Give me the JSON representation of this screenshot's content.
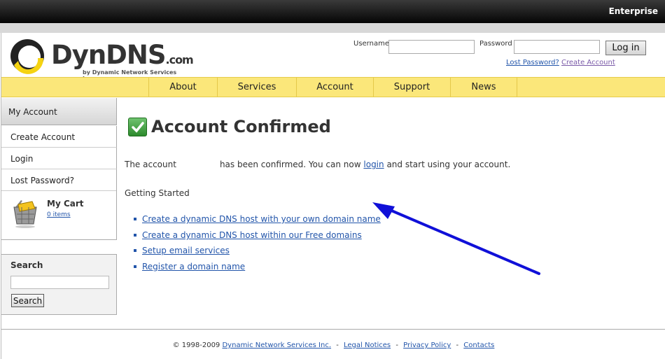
{
  "topbar": {
    "label": "Enterprise"
  },
  "logo": {
    "name": "DynDNS",
    "dotcom": ".com",
    "tagline": "by Dynamic Network Services Inc."
  },
  "login": {
    "username_label": "Username",
    "password_label": "Password",
    "button": "Log in",
    "lost_password": "Lost Password?",
    "create_account": "Create Account"
  },
  "nav": {
    "items": [
      "About",
      "Services",
      "Account",
      "Support",
      "News"
    ]
  },
  "sidebar": {
    "header": "My Account",
    "items": [
      "Create Account",
      "Login",
      "Lost Password?"
    ],
    "cart_title": "My Cart",
    "cart_items": "0 items",
    "search_title": "Search",
    "search_button": "Search"
  },
  "main": {
    "title": "Account Confirmed",
    "msg_before": "The account",
    "msg_middle": "has been confirmed. You can now",
    "msg_link": "login",
    "msg_after": "and start using your account.",
    "getting_started": "Getting Started",
    "links": [
      "Create a dynamic DNS host with your own domain name",
      "Create a dynamic DNS host within our Free domains",
      "Setup email services",
      "Register a domain name"
    ]
  },
  "footer": {
    "copyright": "© 1998-2009",
    "company": "Dynamic Network Services Inc.",
    "legal": "Legal Notices",
    "privacy": "Privacy Policy",
    "contacts": "Contacts"
  },
  "colors": {
    "nav_bg": "#fbe77a",
    "link": "#2255aa",
    "arrow": "#1010d8"
  }
}
